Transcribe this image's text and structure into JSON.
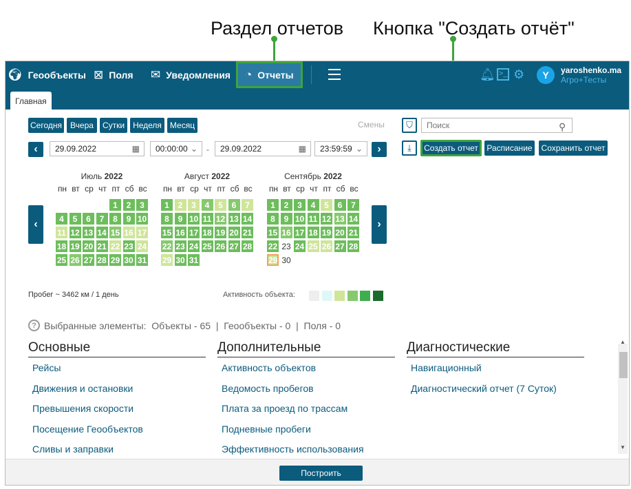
{
  "annotations": {
    "reports_section": "Раздел отчетов",
    "create_button": "Кнопка \"Создать отчёт\""
  },
  "nav": {
    "geo": "Геообъекты",
    "fields": "Поля",
    "notifications": "Уведомления",
    "reports": "Отчеты"
  },
  "user": {
    "initial": "Y",
    "name": "yaroshenko.ma",
    "org": "Агро+Тесты"
  },
  "tabs": {
    "main": "Главная"
  },
  "periods": [
    "Сегодня",
    "Вчера",
    "Сутки",
    "Неделя",
    "Месяц"
  ],
  "shifts": "Смены",
  "date_from": "29.09.2022",
  "time_from": "00:00:00",
  "dash": "-",
  "date_to": "29.09.2022",
  "time_to": "23:59:59",
  "search": {
    "placeholder": "Поиск"
  },
  "actions": {
    "create": "Создать отчет",
    "schedule": "Расписание",
    "save": "Сохранить отчет"
  },
  "weekdays": [
    "пн",
    "вт",
    "ср",
    "чт",
    "пт",
    "сб",
    "вс"
  ],
  "colors": {
    "primary": "#0b5b7d",
    "accent": "#3ea43a",
    "today_border": "#f0a35a",
    "activity": [
      "#eeeeee",
      "#e0f7f7",
      "#cfe59a",
      "#86c96e",
      "#3fae4f",
      "#1d6b2c"
    ]
  },
  "months": [
    {
      "name": "Июль",
      "year": "2022",
      "start": 4,
      "days": [
        null,
        null,
        null,
        null,
        [
          1,
          4
        ],
        [
          2,
          4
        ],
        [
          3,
          4
        ],
        [
          4,
          4
        ],
        [
          5,
          4
        ],
        [
          6,
          4
        ],
        [
          7,
          4
        ],
        [
          8,
          4
        ],
        [
          9,
          4
        ],
        [
          10,
          4
        ],
        [
          11,
          2
        ],
        [
          12,
          4
        ],
        [
          13,
          4
        ],
        [
          14,
          4
        ],
        [
          15,
          3
        ],
        [
          16,
          2
        ],
        [
          17,
          2
        ],
        [
          18,
          4
        ],
        [
          19,
          4
        ],
        [
          20,
          4
        ],
        [
          21,
          4
        ],
        [
          22,
          2
        ],
        [
          23,
          4
        ],
        [
          24,
          2
        ],
        [
          25,
          4
        ],
        [
          26,
          3
        ],
        [
          27,
          4
        ],
        [
          28,
          4
        ],
        [
          29,
          4
        ],
        [
          30,
          4
        ],
        [
          31,
          4
        ]
      ]
    },
    {
      "name": "Август",
      "year": "2022",
      "start": 0,
      "days": [
        [
          1,
          4
        ],
        [
          2,
          2
        ],
        [
          3,
          2
        ],
        [
          4,
          3
        ],
        [
          5,
          2
        ],
        [
          6,
          3
        ],
        [
          7,
          2
        ],
        [
          8,
          4
        ],
        [
          9,
          4
        ],
        [
          10,
          4
        ],
        [
          11,
          4
        ],
        [
          12,
          3
        ],
        [
          13,
          4
        ],
        [
          14,
          4
        ],
        [
          15,
          4
        ],
        [
          16,
          4
        ],
        [
          17,
          4
        ],
        [
          18,
          4
        ],
        [
          19,
          4
        ],
        [
          20,
          4
        ],
        [
          21,
          4
        ],
        [
          22,
          3
        ],
        [
          23,
          4
        ],
        [
          24,
          4
        ],
        [
          25,
          4
        ],
        [
          26,
          4
        ],
        [
          27,
          4
        ],
        [
          28,
          4
        ],
        [
          29,
          2
        ],
        [
          30,
          4
        ],
        [
          31,
          4
        ]
      ]
    },
    {
      "name": "Сентябрь",
      "year": "2022",
      "start": 3,
      "days": [
        [
          1,
          4
        ],
        [
          2,
          4
        ],
        [
          3,
          4
        ],
        [
          4,
          4
        ],
        [
          5,
          2
        ],
        [
          6,
          4
        ],
        [
          7,
          4
        ],
        [
          8,
          4
        ],
        [
          9,
          4
        ],
        [
          10,
          4
        ],
        [
          11,
          4
        ],
        [
          12,
          4
        ],
        [
          13,
          3
        ],
        [
          14,
          4
        ],
        [
          15,
          4
        ],
        [
          16,
          3
        ],
        [
          17,
          4
        ],
        [
          18,
          4
        ],
        [
          19,
          4
        ],
        [
          20,
          4
        ],
        [
          21,
          4
        ],
        [
          22,
          4
        ],
        [
          23,
          0
        ],
        [
          24,
          4
        ],
        [
          25,
          2
        ],
        [
          26,
          2
        ],
        [
          27,
          4
        ],
        [
          28,
          4
        ],
        [
          29,
          5
        ],
        [
          30,
          0
        ]
      ]
    }
  ],
  "mileage": "Пробег ~ 3462 км / 1 день",
  "activity_label": "Активность объекта:",
  "selection": {
    "label": "Выбранные элементы:",
    "objects": "Объекты - 65",
    "sep1": "|",
    "geo": "Геообъекты - 0",
    "sep2": "|",
    "fields": "Поля - 0"
  },
  "groups": [
    {
      "title": "Основные",
      "items": [
        "Рейсы",
        "Движения и остановки",
        "Превышения скорости",
        "Посещение Геообъектов",
        "Сливы и заправки"
      ]
    },
    {
      "title": "Дополнительные",
      "items": [
        "Активность объектов",
        "Ведомость пробегов",
        "Плата за проезд по трассам",
        "Подневные пробеги",
        "Эффективность использования"
      ]
    },
    {
      "title": "Диагностические",
      "items": [
        "Навигационный",
        "Диагностический отчет (7 Суток)"
      ]
    }
  ],
  "build": "Построить"
}
